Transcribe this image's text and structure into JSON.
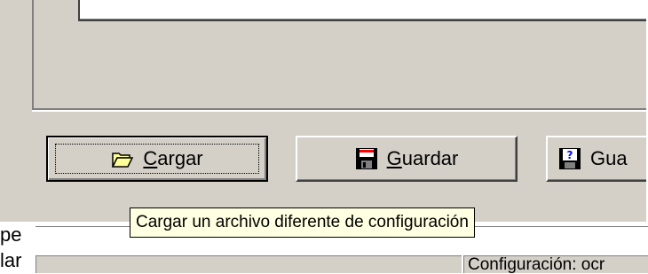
{
  "buttons": {
    "load": {
      "label_prefix": "",
      "label_underlined": "C",
      "label_rest": "argar",
      "icon": "open-folder-icon"
    },
    "save": {
      "label_underlined": "G",
      "label_rest": "uardar",
      "icon": "floppy-disk-icon"
    },
    "save_as": {
      "label_visible": "Gua",
      "icon": "floppy-help-icon"
    }
  },
  "tooltip": {
    "text": "Cargar un archivo diferente de configuración"
  },
  "side_labels": {
    "line1": "pe",
    "line2": "lar"
  },
  "fields": {
    "config_text": "Configuración: ocr"
  },
  "colors": {
    "face": "#d4d0c8",
    "tooltip_bg": "#ffffe1",
    "shadow": "#808080"
  }
}
